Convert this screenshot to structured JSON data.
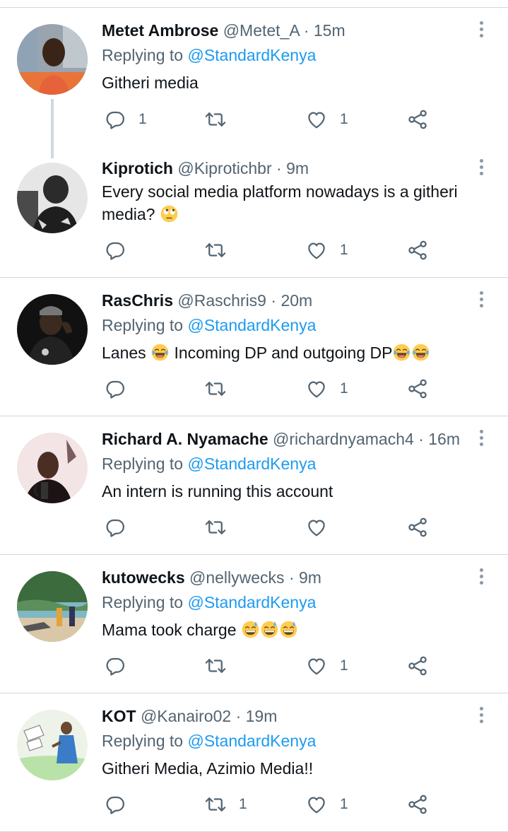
{
  "replying_label": "Replying to",
  "colors": {
    "accent": "#1d9bf0",
    "secondary": "#536471",
    "divider": "#cfd9de",
    "emoji": "#ffcc4d"
  },
  "icons": {
    "reply": "reply-icon",
    "retweet": "retweet-icon",
    "like": "heart-icon",
    "share": "share-icon",
    "more": "more-vertical-icon"
  },
  "tweets": [
    {
      "name": "Metet Ambrose",
      "handle": "@Metet_A",
      "dot": "·",
      "time": "15m",
      "replying_to": "@StandardKenya",
      "text": "Githeri media",
      "reply_count": "1",
      "retweet_count": "",
      "like_count": "1"
    },
    {
      "name": "Kiprotich",
      "handle": "@Kiprotichbr",
      "dot": "·",
      "time": "9m",
      "replying_to": "",
      "text": "Every social media platform nowadays is a githeri media?",
      "emoji": "face-with-rolling-eyes",
      "reply_count": "",
      "retweet_count": "",
      "like_count": "1"
    },
    {
      "name": "RasChris",
      "handle": "@Raschris9",
      "dot": "·",
      "time": "20m",
      "replying_to": "@StandardKenya",
      "text_a": "Lanes",
      "text_b": "Incoming DP and outgoing DP",
      "emoji": "face-with-tears-of-joy",
      "reply_count": "",
      "retweet_count": "",
      "like_count": "1"
    },
    {
      "name": "Richard A. Nyamache",
      "handle": "@richardnyamach4",
      "dot": "·",
      "time": "16m",
      "replying_to": "@StandardKenya",
      "text": "An intern is running this account",
      "reply_count": "",
      "retweet_count": "",
      "like_count": ""
    },
    {
      "name": "kutowecks",
      "handle": "@nellywecks",
      "dot": "·",
      "time": "9m",
      "replying_to": "@StandardKenya",
      "text": "Mama took charge",
      "emoji": "grinning-face-with-sweat",
      "reply_count": "",
      "retweet_count": "",
      "like_count": "1"
    },
    {
      "name": "KOT",
      "handle": "@Kanairo02",
      "dot": "·",
      "time": "19m",
      "replying_to": "@StandardKenya",
      "text": "Githeri Media, Azimio Media!!",
      "reply_count": "",
      "retweet_count": "1",
      "like_count": "1"
    }
  ]
}
